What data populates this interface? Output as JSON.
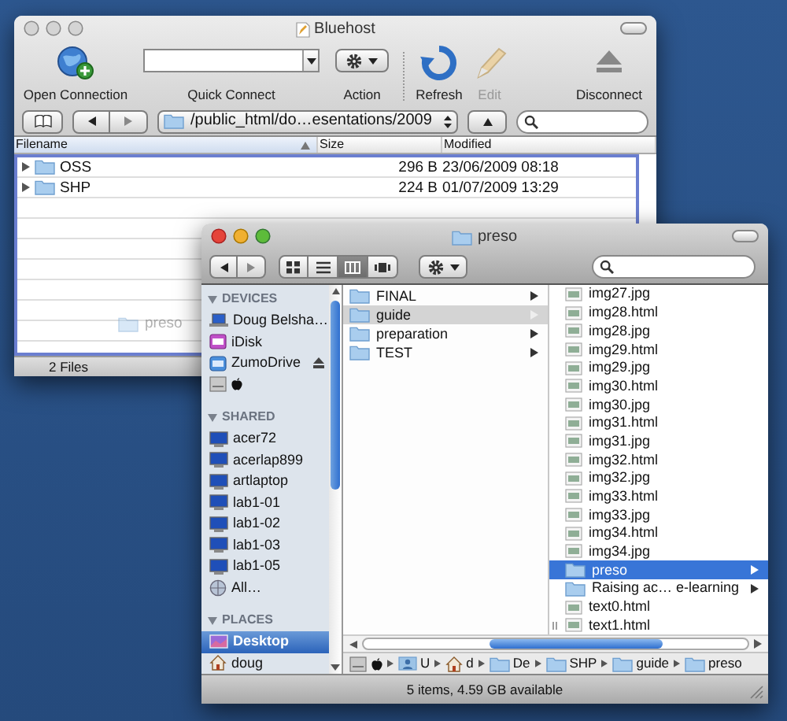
{
  "ftp_window": {
    "title": "Bluehost",
    "toolbar": [
      {
        "kind": "connect",
        "label": "Open Connection",
        "disabled": false
      },
      {
        "kind": "combo",
        "label": "Quick Connect",
        "disabled": false
      },
      {
        "kind": "action",
        "label": "Action",
        "disabled": false
      },
      {
        "kind": "refresh",
        "label": "Refresh",
        "disabled": false
      },
      {
        "kind": "edit",
        "label": "Edit",
        "disabled": true
      },
      {
        "kind": "eject",
        "label": "Disconnect",
        "disabled": false
      }
    ],
    "path": "/public_html/do…esentations/2009",
    "columns": [
      {
        "label": "Filename",
        "sorted": true
      },
      {
        "label": "Size",
        "sorted": false
      },
      {
        "label": "Modified",
        "sorted": false
      }
    ],
    "rows": [
      {
        "name": "OSS",
        "size": "296 B",
        "modified": "23/06/2009 08:18",
        "expanded": false
      },
      {
        "name": "SHP",
        "size": "224 B",
        "modified": "01/07/2009 13:29",
        "expanded": false
      }
    ],
    "drag_ghost": "preso",
    "status_bar": "2 Files"
  },
  "finder_window": {
    "title": "preso",
    "view_buttons": [
      {
        "kind": "icons",
        "selected": false
      },
      {
        "kind": "list",
        "selected": false
      },
      {
        "kind": "columns",
        "selected": true
      },
      {
        "kind": "coverflow",
        "selected": false
      }
    ],
    "sidebar": [
      {
        "heading": "DEVICES",
        "items": [
          {
            "kind": "laptop",
            "label": "Doug Belsha…",
            "selected": false,
            "ejectable": false
          },
          {
            "kind": "idisk",
            "label": "iDisk",
            "selected": false,
            "ejectable": false
          },
          {
            "kind": "drive",
            "label": "ZumoDrive",
            "selected": false,
            "ejectable": true
          },
          {
            "kind": "disk",
            "selected": false,
            "ejectable": false
          }
        ]
      },
      {
        "heading": "SHARED",
        "items": [
          {
            "kind": "computer",
            "label": "acer72",
            "selected": false,
            "ejectable": false
          },
          {
            "kind": "computer",
            "label": "acerlap899",
            "selected": false,
            "ejectable": false
          },
          {
            "kind": "computer",
            "label": "artlaptop",
            "selected": false,
            "ejectable": false
          },
          {
            "kind": "computer",
            "label": "lab1-01",
            "selected": false,
            "ejectable": false
          },
          {
            "kind": "computer",
            "label": "lab1-02",
            "selected": false,
            "ejectable": false
          },
          {
            "kind": "computer",
            "label": "lab1-03",
            "selected": false,
            "ejectable": false
          },
          {
            "kind": "computer",
            "label": "lab1-05",
            "selected": false,
            "ejectable": false
          },
          {
            "kind": "network",
            "label": "All…",
            "selected": false,
            "ejectable": false
          }
        ]
      },
      {
        "heading": "PLACES",
        "items": [
          {
            "kind": "desktop",
            "label": "Desktop",
            "selected": true,
            "ejectable": false
          },
          {
            "kind": "home",
            "label": "doug",
            "selected": false,
            "ejectable": false
          }
        ]
      }
    ],
    "columns": [
      {
        "focused": false,
        "items": [
          {
            "label": "FINAL",
            "kind": "folder",
            "selected": false
          },
          {
            "label": "guide",
            "kind": "folder",
            "selected": true
          },
          {
            "label": "preparation",
            "kind": "folder",
            "selected": false
          },
          {
            "label": "TEST",
            "kind": "folder",
            "selected": false
          }
        ]
      },
      {
        "focused": true,
        "items": [
          {
            "label": "img27.jpg",
            "kind": "file",
            "selected": false
          },
          {
            "label": "img28.html",
            "kind": "file",
            "selected": false
          },
          {
            "label": "img28.jpg",
            "kind": "file",
            "selected": false
          },
          {
            "label": "img29.html",
            "kind": "file",
            "selected": false
          },
          {
            "label": "img29.jpg",
            "kind": "file",
            "selected": false
          },
          {
            "label": "img30.html",
            "kind": "file",
            "selected": false
          },
          {
            "label": "img30.jpg",
            "kind": "file",
            "selected": false
          },
          {
            "label": "img31.html",
            "kind": "file",
            "selected": false
          },
          {
            "label": "img31.jpg",
            "kind": "file",
            "selected": false
          },
          {
            "label": "img32.html",
            "kind": "file",
            "selected": false
          },
          {
            "label": "img32.jpg",
            "kind": "file",
            "selected": false
          },
          {
            "label": "img33.html",
            "kind": "file",
            "selected": false
          },
          {
            "label": "img33.jpg",
            "kind": "file",
            "selected": false
          },
          {
            "label": "img34.html",
            "kind": "file",
            "selected": false
          },
          {
            "label": "img34.jpg",
            "kind": "file",
            "selected": false
          },
          {
            "label": "preso",
            "kind": "folder",
            "selected": true
          },
          {
            "label": "Raising ac… e-learning",
            "kind": "folder",
            "selected": false
          },
          {
            "label": "text0.html",
            "kind": "file",
            "selected": false
          },
          {
            "label": "text1.html",
            "kind": "file",
            "selected": false
          }
        ]
      }
    ],
    "path_bar": [
      {
        "kind": "disk"
      },
      {
        "kind": "apple"
      },
      {
        "kind": "user",
        "label": "U"
      },
      {
        "kind": "home",
        "label": "d"
      },
      {
        "kind": "folder",
        "label": "De"
      },
      {
        "kind": "folder",
        "label": "SHP"
      },
      {
        "kind": "folder",
        "label": "guide"
      },
      {
        "kind": "folder",
        "label": "preso"
      }
    ],
    "status_bar": "5 items, 4.59 GB available"
  }
}
